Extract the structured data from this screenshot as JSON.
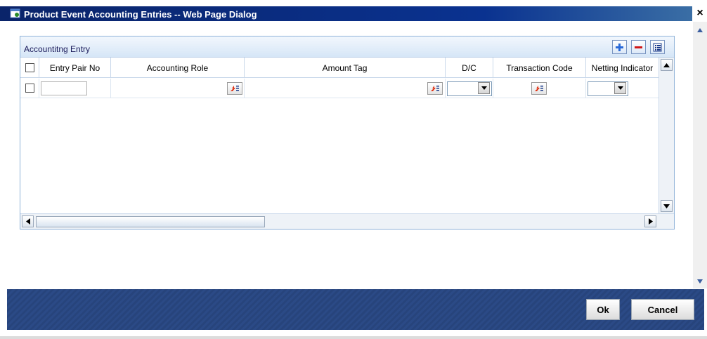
{
  "window": {
    "title": "Product Event Accounting Entries -- Web Page Dialog",
    "close_label": "×"
  },
  "section": {
    "title": "Accountitng Entry"
  },
  "toolbar": {
    "add_label": "+",
    "delete_label": "−",
    "view_label": "☰"
  },
  "grid": {
    "columns": {
      "entry_pair_no": "Entry Pair No",
      "accounting_role": "Accounting Role",
      "amount_tag": "Amount Tag",
      "dc": "D/C",
      "transaction_code": "Transaction Code",
      "netting_indicator": "Netting Indicator"
    },
    "row": {
      "entry_pair_no": "",
      "accounting_role": "",
      "amount_tag": "",
      "dc": "",
      "transaction_code": "",
      "netting_indicator": ""
    }
  },
  "footer": {
    "ok_label": "Ok",
    "cancel_label": "Cancel"
  },
  "icons": {
    "lov": "list-of-values-icon",
    "dropdown": "chevron-down-icon"
  },
  "colors": {
    "title_bar": "#0a246a",
    "section_header": "#d6e6f7",
    "footer": "#2b4a86"
  }
}
